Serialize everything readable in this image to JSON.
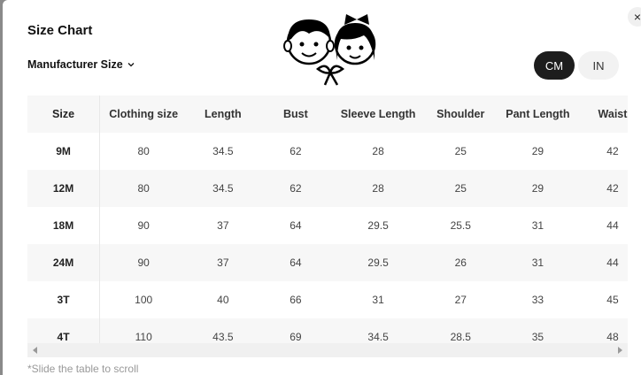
{
  "title": "Size Chart",
  "manufacturer_label": "Manufacturer Size",
  "units": {
    "cm": "CM",
    "in": "IN"
  },
  "close": "×",
  "table": {
    "headers": [
      "Size",
      "Clothing size",
      "Length",
      "Bust",
      "Sleeve Length",
      "Shoulder",
      "Pant Length",
      "Waist"
    ],
    "rows": [
      [
        "9M",
        "80",
        "34.5",
        "62",
        "28",
        "25",
        "29",
        "42"
      ],
      [
        "12M",
        "80",
        "34.5",
        "62",
        "28",
        "25",
        "29",
        "42"
      ],
      [
        "18M",
        "90",
        "37",
        "64",
        "29.5",
        "25.5",
        "31",
        "44"
      ],
      [
        "24M",
        "90",
        "37",
        "64",
        "29.5",
        "26",
        "31",
        "44"
      ],
      [
        "3T",
        "100",
        "40",
        "66",
        "31",
        "27",
        "33",
        "45"
      ],
      [
        "4T",
        "110",
        "43.5",
        "69",
        "34.5",
        "28.5",
        "35",
        "48"
      ]
    ]
  },
  "scroll_note": "*Slide the table to scroll"
}
